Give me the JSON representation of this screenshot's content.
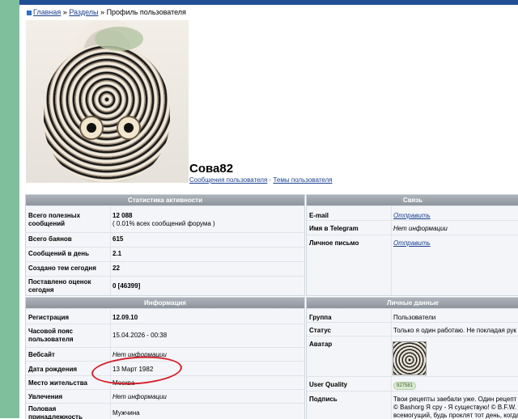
{
  "breadcrumb": {
    "home": "Главная",
    "sep1": "»",
    "sections": "Разделы",
    "sep2": "»",
    "current": "Профиль пользователя"
  },
  "user": {
    "name": "Сова82",
    "posts_link": "Сообщения пользователя",
    "separator": "·",
    "topics_link": "Темы пользователя"
  },
  "activity": {
    "header": "Статистика активности",
    "rows": [
      {
        "label": "Всего полезных сообщений",
        "value": "12 088",
        "sub": "( 0.01% всех сообщений форума )"
      },
      {
        "label": "Всего баянов",
        "value": "615"
      },
      {
        "label": "Сообщений в день",
        "value": "2.1"
      },
      {
        "label": "Создано тем сегодня",
        "value": "22"
      },
      {
        "label": "Поставлено оценок сегодня",
        "value": "0 [46399]"
      }
    ]
  },
  "contact": {
    "header": "Связь",
    "rows": [
      {
        "label": "E-mail",
        "value": "Отправить"
      },
      {
        "label": "Имя в Telegram",
        "value": "Нет информации"
      },
      {
        "label": "Личное письмо",
        "value": "Отправить"
      }
    ]
  },
  "info": {
    "header": "Информация",
    "rows": [
      {
        "label": "Регистрация",
        "value": "12.09.10"
      },
      {
        "label": "Часовой пояс пользователя",
        "value": "15.04.2026 - 00:38"
      },
      {
        "label": "Вебсайт",
        "value": "Нет информации"
      },
      {
        "label": "Дата рождения",
        "value": "13 Март 1982"
      },
      {
        "label": "Место жительства",
        "value": "Москва"
      },
      {
        "label": "Увлечения",
        "value": "Нет информации"
      },
      {
        "label": "Половая принадлежность",
        "value": "Мужчина"
      }
    ]
  },
  "personal": {
    "header": "Личные данные",
    "rows": [
      {
        "label": "Группа",
        "value": "Пользователи"
      },
      {
        "label": "Статус",
        "value": "Только я один работаю. Не покладая рук"
      },
      {
        "label": "Аватар"
      },
      {
        "label": "User Quality",
        "value": "927581"
      },
      {
        "label": "Подпись",
        "line1": "Твои рецепты заебали уже. Один рецепт о",
        "line2": "© Bashorg Я сру - Я существую! © B.F.W. Va",
        "line3": "всемогущий, будь проклят тот день, когда"
      }
    ]
  },
  "colors": {
    "accent": "#1f4e95",
    "annotation": "#d51d2a"
  }
}
